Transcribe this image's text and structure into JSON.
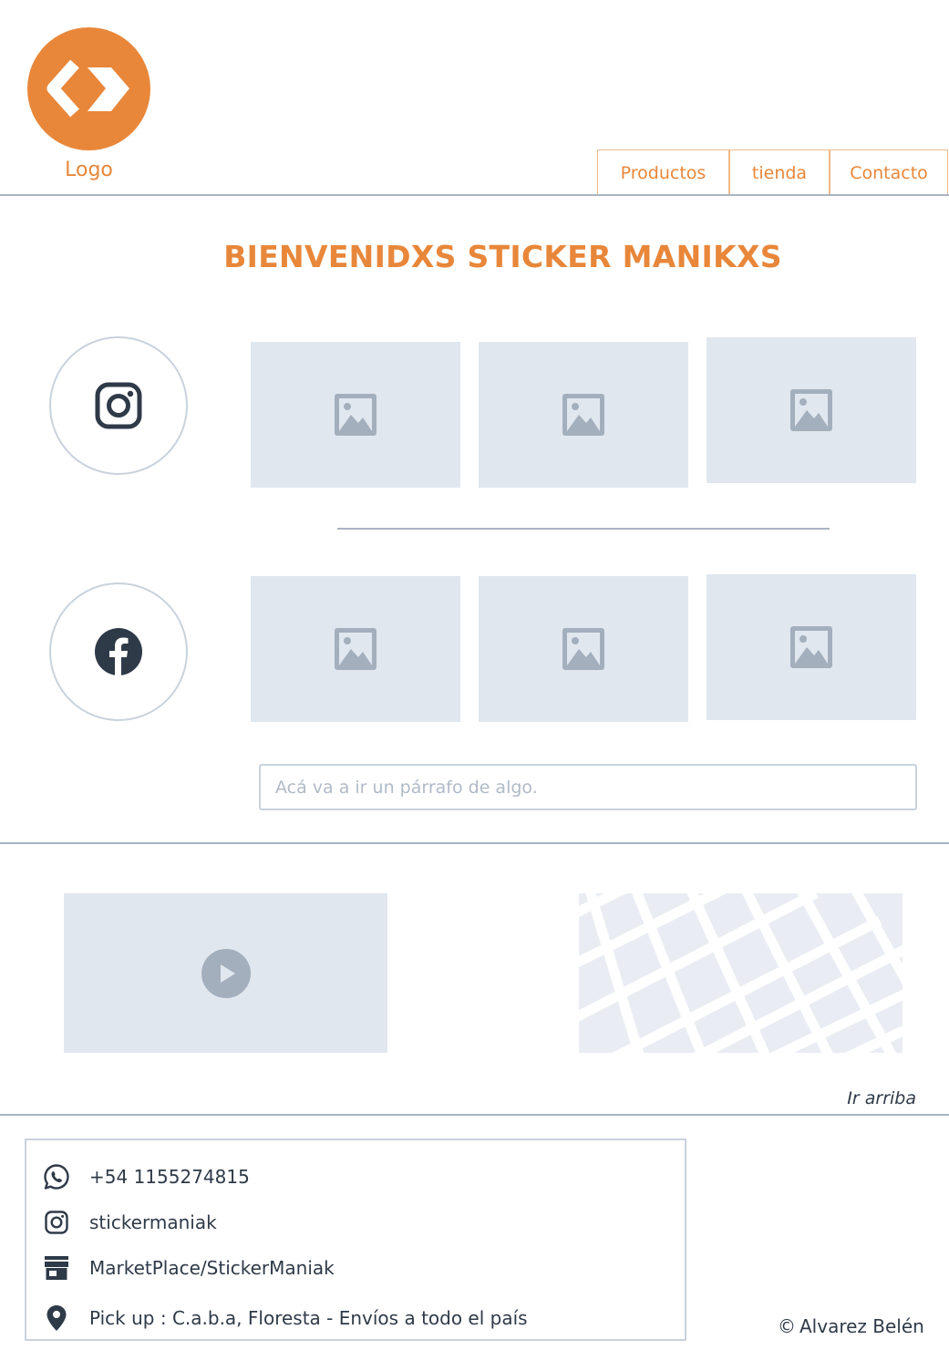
{
  "header": {
    "logo_label": "Logo",
    "nav": [
      {
        "label": "Productos"
      },
      {
        "label": "tienda"
      },
      {
        "label": "Contacto"
      }
    ]
  },
  "main": {
    "title": "BIENVENIDXS STICKER MANIKXS",
    "social_rows": [
      {
        "icon": "instagram-icon",
        "images": [
          "image-placeholder",
          "image-placeholder",
          "image-placeholder"
        ]
      },
      {
        "icon": "facebook-icon",
        "images": [
          "image-placeholder",
          "image-placeholder",
          "image-placeholder"
        ]
      }
    ],
    "paragraph_placeholder": "Acá va a ir un párrafo de algo."
  },
  "media": {
    "video_icon": "play-icon",
    "map": "map-placeholder",
    "back_to_top": "Ir arriba"
  },
  "footer": {
    "contacts": [
      {
        "icon": "whatsapp-icon",
        "text": "+54 1155274815"
      },
      {
        "icon": "instagram-icon",
        "text": "stickermaniak"
      },
      {
        "icon": "store-icon",
        "text": "MarketPlace/StickerManiak"
      },
      {
        "icon": "location-pin-icon",
        "text": "Pick up : C.a.b.a, Floresta - Envíos a todo el país"
      }
    ],
    "copyright_symbol": "©",
    "copyright": "Alvarez Belén"
  },
  "colors": {
    "accent": "#e8873a",
    "placeholder_bg": "#e1e7ef",
    "placeholder_icon": "#a3afbd",
    "border": "#c9d2dd",
    "text": "#2f3a48"
  }
}
